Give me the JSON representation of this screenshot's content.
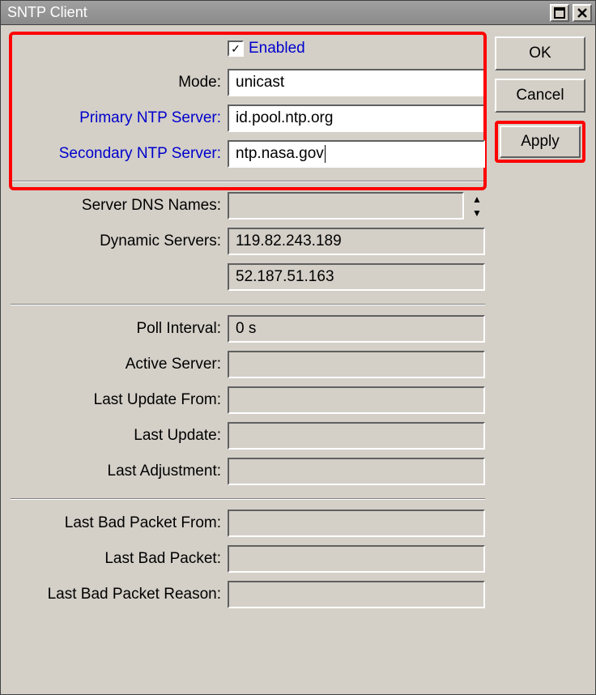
{
  "window": {
    "title": "SNTP Client"
  },
  "buttons": {
    "ok": "OK",
    "cancel": "Cancel",
    "apply": "Apply"
  },
  "labels": {
    "enabled": "Enabled",
    "mode": "Mode:",
    "primary": "Primary NTP Server:",
    "secondary": "Secondary NTP Server:",
    "dns": "Server DNS Names:",
    "dynamic": "Dynamic Servers:",
    "poll": "Poll Interval:",
    "active": "Active Server:",
    "lastUpdateFrom": "Last Update From:",
    "lastUpdate": "Last Update:",
    "lastAdj": "Last Adjustment:",
    "lastBadFrom": "Last Bad Packet From:",
    "lastBad": "Last Bad Packet:",
    "lastBadReason": "Last Bad Packet Reason:"
  },
  "fields": {
    "mode": "unicast",
    "primary": "id.pool.ntp.org",
    "secondary": "ntp.nasa.gov",
    "dns": "",
    "dynamic1": "119.82.243.189",
    "dynamic2": "52.187.51.163",
    "poll": "0 s",
    "active": "",
    "lastUpdateFrom": "",
    "lastUpdate": "",
    "lastAdj": "",
    "lastBadFrom": "",
    "lastBad": "",
    "lastBadReason": ""
  },
  "state": {
    "enabledChecked": true
  },
  "highlight": {
    "color": "#ff0000"
  }
}
